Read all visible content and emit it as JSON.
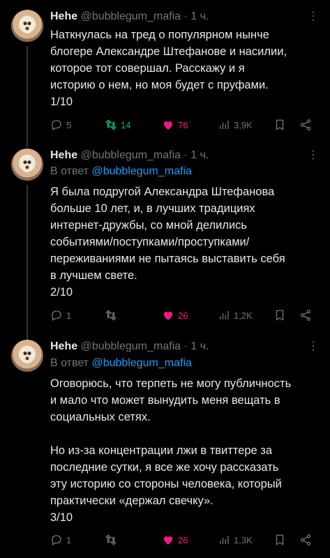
{
  "tweets": [
    {
      "name": "Hehe",
      "handle": "@bubblegum_mafia",
      "sep": "·",
      "time": "1 ч.",
      "more": "⋮",
      "reply_prefix": "",
      "reply_to": "",
      "text": "Наткнулась на тред о популярном нынче\nблогере Александре Штефанове и насилии,\nкоторое тот совершал. Расскажу и я\nисторию о нем, но моя будет с пруфами.\n1/10",
      "replies": "5",
      "retweets": "14",
      "likes": "76",
      "views": "3,9K"
    },
    {
      "name": "Hehe",
      "handle": "@bubblegum_mafia",
      "sep": "·",
      "time": "1 ч.",
      "more": "⋮",
      "reply_prefix": "В ответ",
      "reply_to": "@bubblegum_mafia",
      "text": "Я была подругой Александра Штефанова\nбольше 10 лет, и, в лучших традициях\nинтернет-дружбы, со мной делились\nсобытиями/поступками/проступками/\nпереживаниями не пытаясь выставить себя\nв лучшем свете.\n2/10",
      "replies": "1",
      "retweets": "",
      "likes": "26",
      "views": "1,2K"
    },
    {
      "name": "Hehe",
      "handle": "@bubblegum_mafia",
      "sep": "·",
      "time": "1 ч.",
      "more": "⋮",
      "reply_prefix": "В ответ",
      "reply_to": "@bubblegum_mafia",
      "text": "Оговорюсь, что терпеть не могу публичность\nи мало что может вынудить меня вещать в\nсоциальных сетях.\n\nНо из-за концентрации лжи в твиттере за\nпоследние сутки, я все же хочу рассказать\nэту историю со стороны человека, который\nпрактически «держал свечку».\n3/10",
      "replies": "1",
      "retweets": "",
      "likes": "26",
      "views": "1,3K"
    }
  ],
  "colors": {
    "background": "#000000",
    "text": "#e7e9ea",
    "muted": "#71767b",
    "link": "#1d9bf0",
    "like": "#f91880",
    "retweet": "#00ba7c"
  }
}
